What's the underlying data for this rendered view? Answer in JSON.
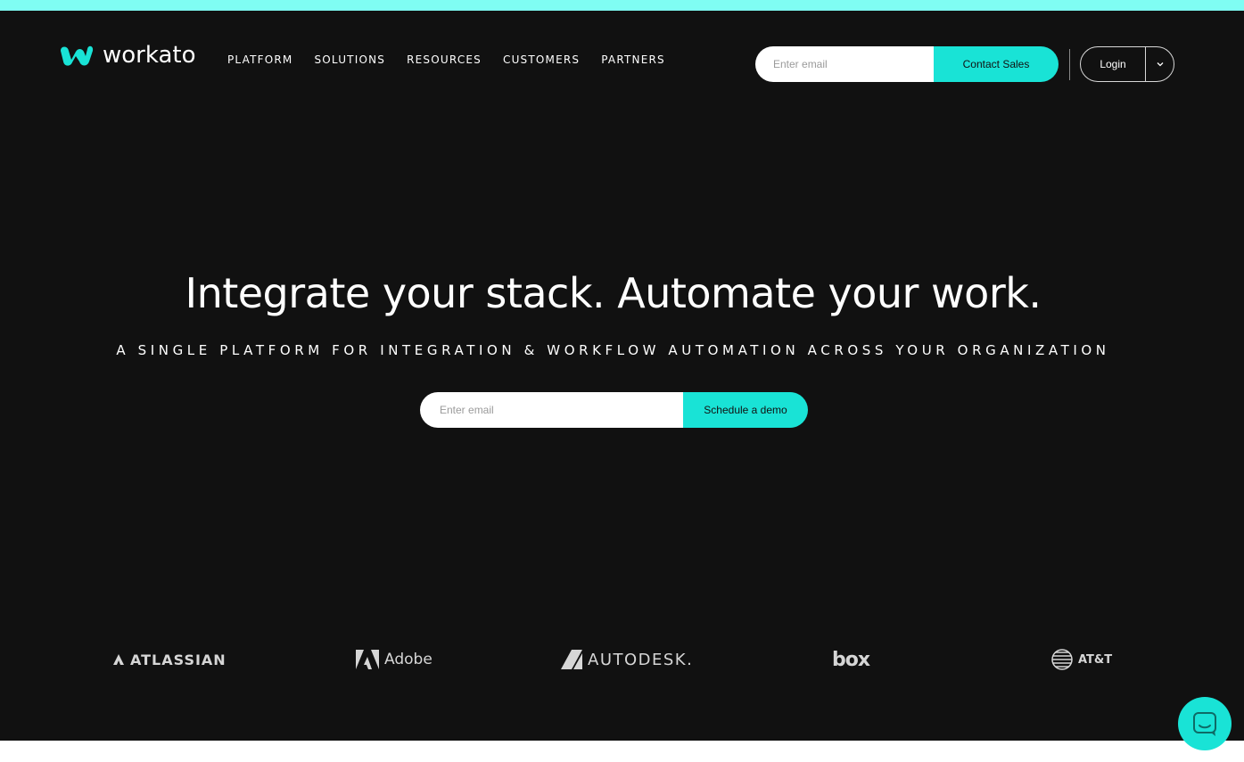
{
  "brand": {
    "name": "workato",
    "accent": "#19e3d6",
    "background": "#111111",
    "top_strip": "#7ffdf3"
  },
  "nav": {
    "items": [
      {
        "label": "PLATFORM"
      },
      {
        "label": "SOLUTIONS"
      },
      {
        "label": "RESOURCES"
      },
      {
        "label": "CUSTOMERS"
      },
      {
        "label": "PARTNERS"
      }
    ]
  },
  "header": {
    "email_placeholder": "Enter email",
    "contact_label": "Contact Sales",
    "login_label": "Login",
    "login_caret_icon": "chevron-down-icon"
  },
  "hero": {
    "title": "Integrate your stack. Automate your work.",
    "subtitle": "A SINGLE PLATFORM FOR INTEGRATION & WORKFLOW AUTOMATION ACROSS YOUR ORGANIZATION",
    "email_placeholder": "Enter email",
    "cta_label": "Schedule a demo"
  },
  "customers": {
    "logos": [
      {
        "name": "ATLASSIAN",
        "icon": "atlassian-logo"
      },
      {
        "name": "Adobe",
        "icon": "adobe-logo"
      },
      {
        "name": "AUTODESK.",
        "icon": "autodesk-logo"
      },
      {
        "name": "box",
        "icon": "box-logo"
      },
      {
        "name": "AT&T",
        "icon": "att-logo"
      }
    ]
  },
  "chat": {
    "icon": "chat-bubble-icon"
  }
}
